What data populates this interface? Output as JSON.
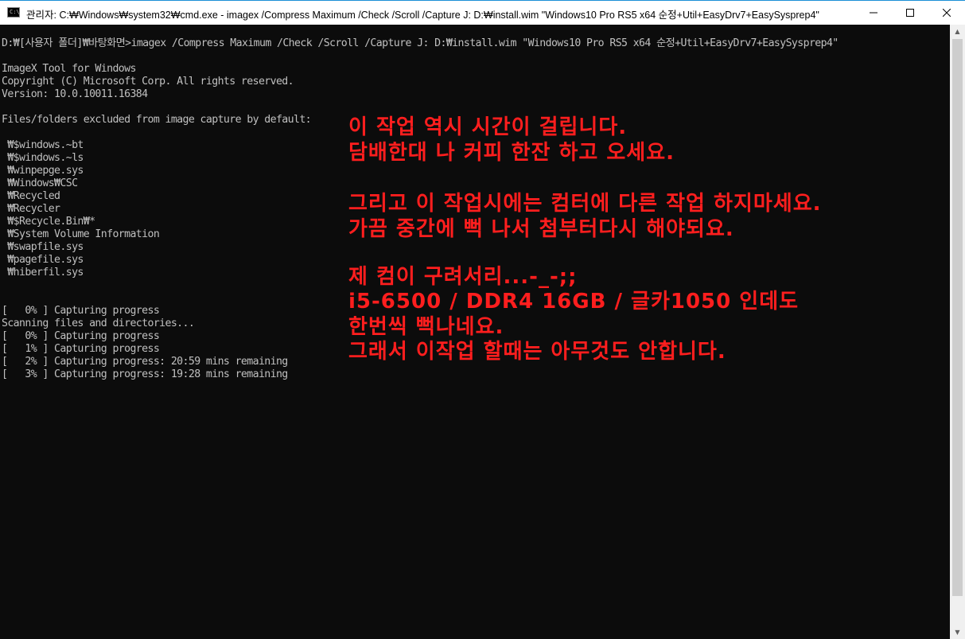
{
  "window": {
    "icon_text": "C:\\",
    "title": "관리자: C:₩Windows₩system32₩cmd.exe - imagex  /Compress Maximum /Check /Scroll /Capture J: D:₩install.wim \"Windows10 Pro RS5 x64 순정+Util+EasyDrv7+EasySysprep4\"",
    "icons": {
      "minimize": "minimize-icon",
      "maximize": "maximize-icon",
      "close": "close-icon"
    }
  },
  "console": {
    "lines": [
      "D:₩[사용자 폴더]₩바탕화면>imagex /Compress Maximum /Check /Scroll /Capture J: D:₩install.wim \"Windows10 Pro RS5 x64 순정+Util+EasyDrv7+EasySysprep4\"",
      "",
      "ImageX Tool for Windows",
      "Copyright (C) Microsoft Corp. All rights reserved.",
      "Version: 10.0.10011.16384",
      "",
      "Files/folders excluded from image capture by default:",
      "",
      " ₩$windows.~bt",
      " ₩$windows.~ls",
      " ₩winpepge.sys",
      " ₩Windows₩CSC",
      " ₩Recycled",
      " ₩Recycler",
      " ₩$Recycle.Bin₩*",
      " ₩System Volume Information",
      " ₩swapfile.sys",
      " ₩pagefile.sys",
      " ₩hiberfil.sys",
      "",
      "",
      "[   0% ] Capturing progress",
      "Scanning files and directories...",
      "[   0% ] Capturing progress",
      "[   1% ] Capturing progress",
      "[   2% ] Capturing progress: 20:59 mins remaining",
      "[   3% ] Capturing progress: 19:28 mins remaining"
    ]
  },
  "annotation": {
    "lines": [
      "이 작업 역시 시간이 걸립니다.",
      "담배한대 나 커피 한잔 하고 오세요.",
      "",
      "그리고 이 작업시에는 컴터에 다른 작업 하지마세요.",
      "가끔 중간에 뻑 나서 첨부터다시 해야되요.",
      "",
      "제 컴이 구려서리...-_-;;",
      "i5-6500 / DDR4 16GB / 글카1050 인데도",
      "한번씩 뻑나네요.",
      "그래서 이작업 할때는 아무것도 안합니다."
    ],
    "color": "#ff1e1e"
  },
  "colors": {
    "console_bg": "#0c0c0c",
    "console_text": "#c0c0c0",
    "titlebar_border": "#1b8fd6"
  }
}
